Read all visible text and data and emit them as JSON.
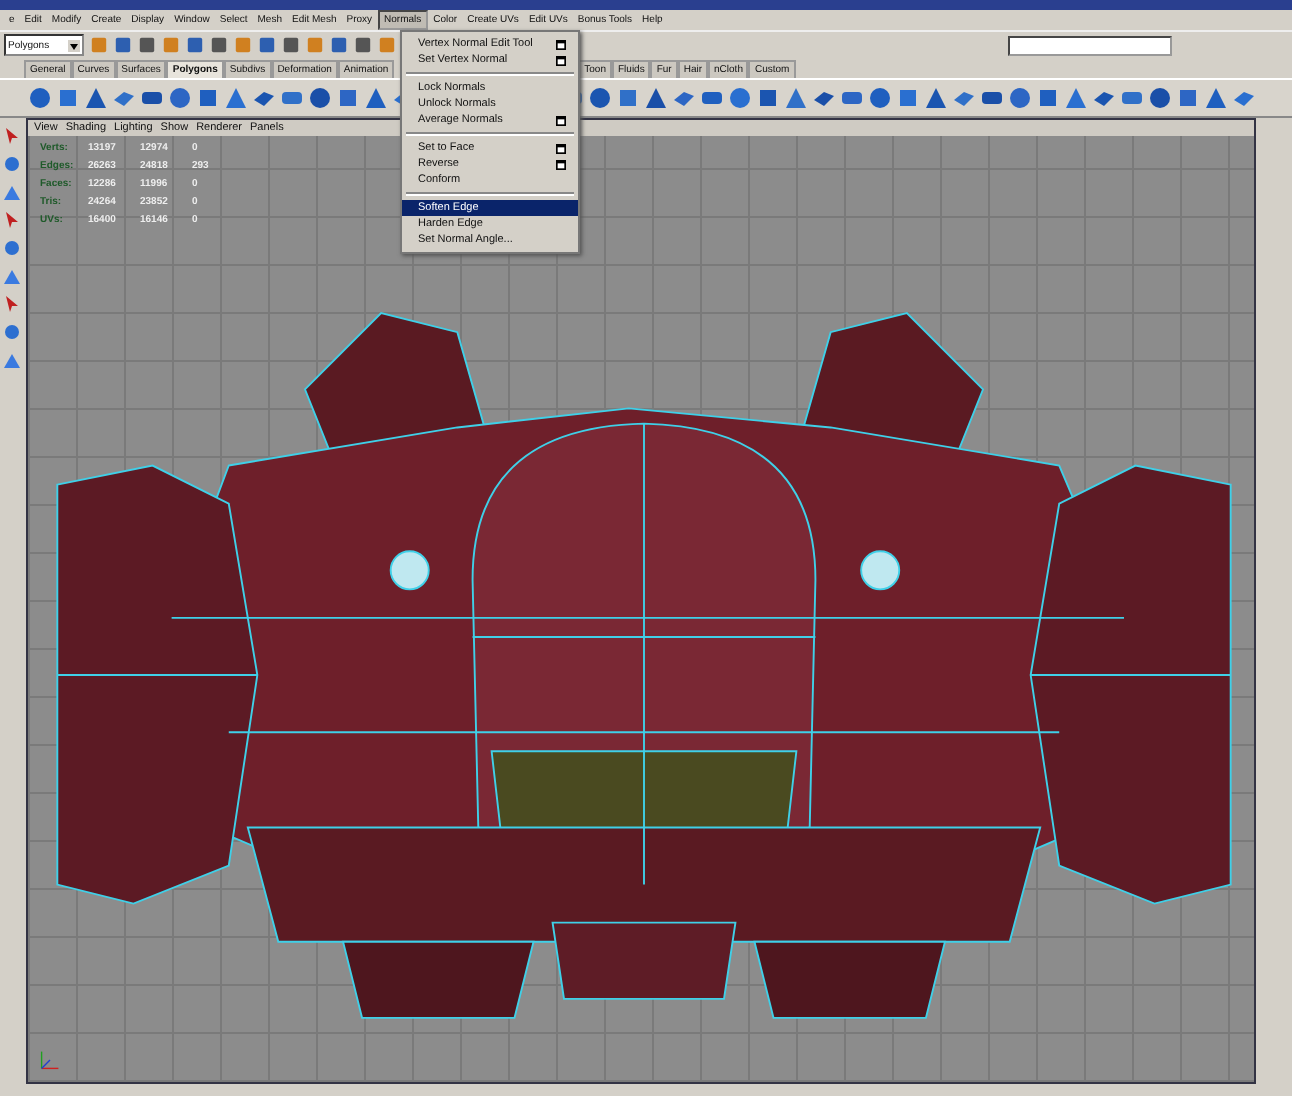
{
  "menu_bar": [
    {
      "label": "e",
      "open": false
    },
    {
      "label": "Edit",
      "open": false
    },
    {
      "label": "Modify",
      "open": false
    },
    {
      "label": "Create",
      "open": false
    },
    {
      "label": "Display",
      "open": false
    },
    {
      "label": "Window",
      "open": false
    },
    {
      "label": "Select",
      "open": false
    },
    {
      "label": "Mesh",
      "open": false
    },
    {
      "label": "Edit Mesh",
      "open": false
    },
    {
      "label": "Proxy",
      "open": false
    },
    {
      "label": "Normals",
      "open": true
    },
    {
      "label": "Color",
      "open": false
    },
    {
      "label": "Create UVs",
      "open": false
    },
    {
      "label": "Edit UVs",
      "open": false
    },
    {
      "label": "Bonus Tools",
      "open": false
    },
    {
      "label": "Help",
      "open": false
    }
  ],
  "status_line": {
    "menu_set": "Polygons"
  },
  "shelf_tabs": [
    {
      "label": "General",
      "selected": false
    },
    {
      "label": "Curves",
      "selected": false
    },
    {
      "label": "Surfaces",
      "selected": false
    },
    {
      "label": "Polygons",
      "selected": true
    },
    {
      "label": "Subdivs",
      "selected": false
    },
    {
      "label": "Deformation",
      "selected": false
    },
    {
      "label": "Animation",
      "selected": false
    },
    {
      "label": "Toon",
      "selected": false
    },
    {
      "label": "Fluids",
      "selected": false
    },
    {
      "label": "Fur",
      "selected": false
    },
    {
      "label": "Hair",
      "selected": false
    },
    {
      "label": "nCloth",
      "selected": false
    },
    {
      "label": "Custom",
      "selected": false
    }
  ],
  "panel_menu": [
    "View",
    "Shading",
    "Lighting",
    "Show",
    "Renderer",
    "Panels"
  ],
  "hud_stats": [
    {
      "label": "Verts:",
      "values": [
        "13197",
        "12974",
        "0"
      ]
    },
    {
      "label": "Edges:",
      "values": [
        "26263",
        "24818",
        "293"
      ]
    },
    {
      "label": "Faces:",
      "values": [
        "12286",
        "11996",
        "0"
      ]
    },
    {
      "label": "Tris:",
      "values": [
        "24264",
        "23852",
        "0"
      ]
    },
    {
      "label": "UVs:",
      "values": [
        "16400",
        "16146",
        "0"
      ]
    }
  ],
  "normals_menu": {
    "groups": [
      [
        {
          "label": "Vertex Normal Edit Tool",
          "option_box": true,
          "selected": false
        },
        {
          "label": "Set Vertex Normal",
          "option_box": true,
          "selected": false
        }
      ],
      [
        {
          "label": "Lock Normals",
          "option_box": false,
          "selected": false
        },
        {
          "label": "Unlock Normals",
          "option_box": false,
          "selected": false
        },
        {
          "label": "Average Normals",
          "option_box": true,
          "selected": false
        }
      ],
      [
        {
          "label": "Set to Face",
          "option_box": true,
          "selected": false
        },
        {
          "label": "Reverse",
          "option_box": true,
          "selected": false
        },
        {
          "label": "Conform",
          "option_box": false,
          "selected": false
        }
      ],
      [
        {
          "label": "Soften Edge",
          "option_box": false,
          "selected": true
        },
        {
          "label": "Harden Edge",
          "option_box": false,
          "selected": false
        },
        {
          "label": "Set Normal Angle...",
          "option_box": false,
          "selected": false
        }
      ]
    ]
  }
}
